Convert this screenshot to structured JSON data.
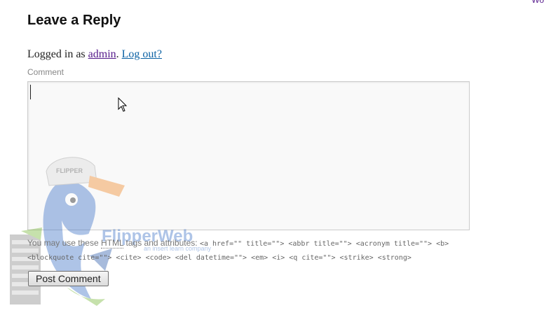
{
  "corner_link": {
    "text": "Wo"
  },
  "reply": {
    "title": "Leave a Reply",
    "logged_in_prefix": "Logged in as ",
    "user": "admin",
    "separator": ". ",
    "logout": "Log out?"
  },
  "form": {
    "comment_label": "Comment",
    "comment_value": "",
    "hint_prefix": "You may use these ",
    "hint_abbr": "HTML",
    "hint_suffix": " tags and attributes: ",
    "allowed_tags": "<a href=\"\" title=\"\"> <abbr title=\"\"> <acronym title=\"\"> <b> <blockquote cite=\"\"> <cite> <code> <del datetime=\"\"> <em> <i> <q cite=\"\"> <strike> <strong>",
    "submit_label": "Post Comment"
  },
  "watermark": {
    "cap_text": "FLIPPER",
    "brand_text": "FlipperWeb",
    "tagline": "an insert learn company"
  },
  "colors": {
    "link_visited": "#551a8b",
    "link": "#0b61a4",
    "label_gray": "#888888",
    "textarea_bg": "#f9f9f9"
  }
}
